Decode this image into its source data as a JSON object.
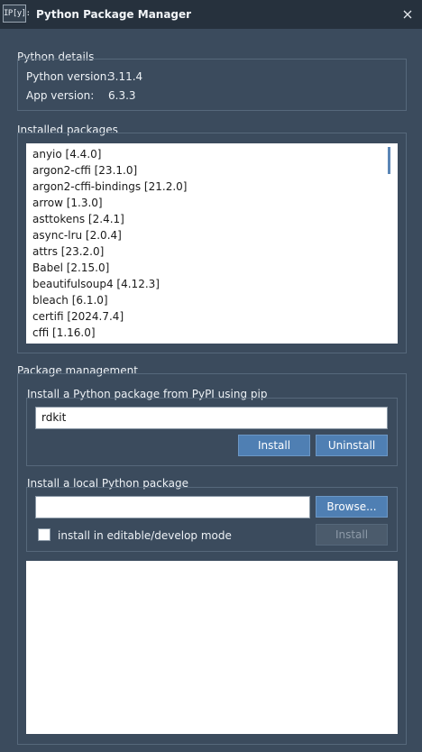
{
  "window": {
    "icon_text": "IP[y]:",
    "title": "Python Package Manager"
  },
  "python_details": {
    "group_label": "Python details",
    "python_version_label": "Python version:",
    "python_version_value": "3.11.4",
    "app_version_label": "App version:",
    "app_version_value": "6.3.3"
  },
  "installed_packages": {
    "group_label": "Installed packages",
    "items": [
      "anyio [4.4.0]",
      "argon2-cffi [23.1.0]",
      "argon2-cffi-bindings [21.2.0]",
      "arrow [1.3.0]",
      "asttokens [2.4.1]",
      "async-lru [2.0.4]",
      "attrs [23.2.0]",
      "Babel [2.15.0]",
      "beautifulsoup4 [4.12.3]",
      "bleach [6.1.0]",
      "certifi [2024.7.4]",
      "cffi [1.16.0]"
    ]
  },
  "package_management": {
    "group_label": "Package management",
    "pypi": {
      "label": "Install a Python package from PyPI using pip",
      "input_value": "rdkit",
      "install_label": "Install",
      "uninstall_label": "Uninstall"
    },
    "local": {
      "label": "Install a local Python package",
      "input_value": "",
      "browse_label": "Browse...",
      "editable_label": "install in editable/develop mode",
      "install_label": "Install"
    }
  },
  "icons": {
    "close": "close-icon",
    "app": "ipython-app-icon"
  }
}
